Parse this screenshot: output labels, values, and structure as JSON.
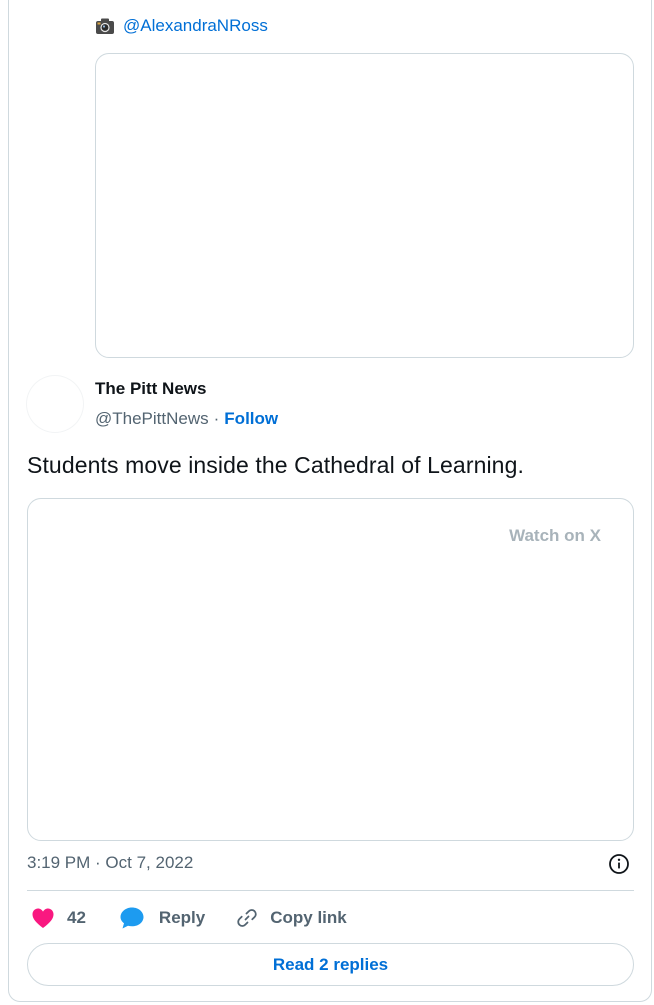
{
  "quoted": {
    "icon": "camera-icon",
    "handle": "@AlexandraNRoss"
  },
  "author": {
    "name": "The Pitt News",
    "handle": "@ThePittNews",
    "separator": "·",
    "follow_label": "Follow"
  },
  "tweet": {
    "text": "Students move inside the Cathedral of Learning.",
    "watch_label": "Watch on X",
    "timestamp": "3:19 PM · Oct 7, 2022"
  },
  "actions": {
    "like_count": "42",
    "reply_label": "Reply",
    "copy_label": "Copy link"
  },
  "read_replies_label": "Read 2 replies",
  "colors": {
    "link": "#006fd6",
    "like": "#f91880",
    "reply": "#1d9bf0",
    "muted": "#536471",
    "border": "#cfd9de"
  }
}
